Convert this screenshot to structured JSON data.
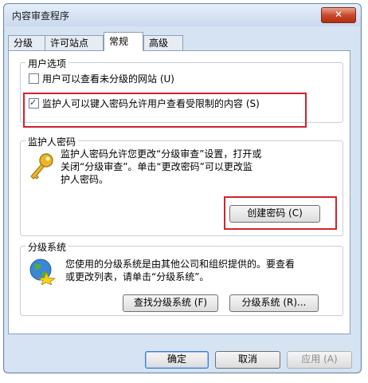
{
  "window": {
    "title": "内容审查程序",
    "close_label": "✕"
  },
  "tabs": [
    "分级",
    "许可站点",
    "常规",
    "高级"
  ],
  "user_options": {
    "legend": "用户选项",
    "option1": "用户可以查看未分级的网站 (U)",
    "option2": "监护人可以键入密码允许用户查看受限制的内容 (S)"
  },
  "supervisor_password": {
    "legend": "监护人密码",
    "desc_line1": "监护人密码允许您更改“分级审查”设置，打开或",
    "desc_line2": "关闭“分级审查”。单击“更改密码”可以更改监",
    "desc_line3": "护人密码。",
    "button": "创建密码 (C)"
  },
  "rating_systems": {
    "legend": "分级系统",
    "desc_line1": "您使用的分级系统是由其他公司和组织提供的。要查看",
    "desc_line2": "或更改列表，请单击“分级系统”。",
    "find_button": "查找分级系统 (F)",
    "systems_button": "分级系统 (R)..."
  },
  "footer": {
    "ok": "确定",
    "cancel": "取消",
    "apply": "应用 (A)"
  },
  "colors": {
    "highlight": "#d4222a",
    "window_bg": "#d6e3f2"
  }
}
